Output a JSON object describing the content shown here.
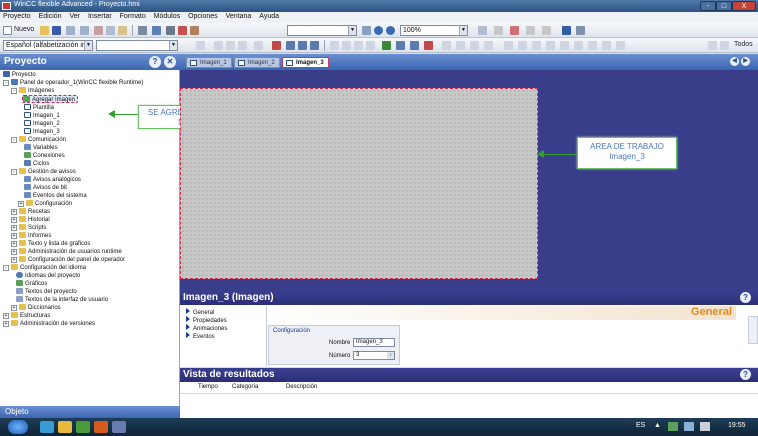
{
  "window": {
    "title": "WinCC flexible Advanced - Proyecto.hmi",
    "minimize": "-",
    "maximize": "□",
    "close": "X"
  },
  "menu": [
    "Proyecto",
    "Edición",
    "Ver",
    "Insertar",
    "Formato",
    "Módulos",
    "Opciones",
    "Ventana",
    "Ayuda"
  ],
  "toolbar": {
    "new_label": "Nuevo",
    "zoom_value": "100%",
    "language_combo": "Español (alfabetización in...",
    "todos_label": "Todos"
  },
  "project_panel": {
    "title": "Proyecto",
    "tree": {
      "root": "Proyecto",
      "operator_panel": "Panel de operador_1(WinCC flexible Runtime)",
      "imagenes": "Imágenes",
      "agregar_imagen": "Agregar Imagen",
      "plantilla": "Plantilla",
      "imagen_1": "Imagen_1",
      "imagen_2": "Imagen_2",
      "imagen_3": "Imagen_3",
      "comunicacion": "Comunicación",
      "variables": "Variables",
      "conexiones": "Conexiones",
      "ciclos": "Ciclos",
      "gestion_avisos": "Gestión de avisos",
      "avisos_analogicos": "Avisos analógicos",
      "avisos_bit": "Avisos de bit",
      "eventos_sistema": "Eventos del sistema",
      "configuracion": "Configuración",
      "recetas": "Recetas",
      "historial": "Historial",
      "scripts": "Scripts",
      "informes": "Informes",
      "texto_graficos": "Texto y lista de gráficos",
      "admin_usuarios": "Administración de usuarios runtime",
      "config_panel": "Configuración del panel de operador",
      "config_idioma": "Configuración del idioma",
      "idiomas_proyecto": "Idiomas del proyecto",
      "graficos": "Gráficos",
      "textos_proyecto": "Textos del proyecto",
      "textos_interfaz": "Textos de la interfaz de usuario",
      "diccionarios": "Diccionarios",
      "estructuras": "Estructuras",
      "admin_versiones": "Administración de versiones"
    }
  },
  "object_panel": {
    "title": "Objeto"
  },
  "editor_tabs": [
    "Imagen_1",
    "Imagen_2",
    "Imagen_3"
  ],
  "annotations": {
    "left_callout": "SE AGREGAN LAS IMÁGENES NECESARIAS.",
    "right_callout_line1": "AREA DE TRABAJO",
    "right_callout_line2": "Imagen_3"
  },
  "properties": {
    "title": "Imagen_3 (Imagen)",
    "categories": [
      "General",
      "Propiedades",
      "Animaciones",
      "Eventos"
    ],
    "section_label": "General",
    "group_title": "Configuración",
    "name_label": "Nombre",
    "name_value": "Imagen_3",
    "number_label": "Número",
    "number_value": "3"
  },
  "results": {
    "title": "Vista de resultados",
    "columns": [
      "Tiempo",
      "Categoría",
      "Descripción"
    ]
  },
  "taskbar": {
    "lang": "ES",
    "time": "19:55"
  },
  "colors": {
    "accent": "#3d66b2",
    "workspace": "#3a3e8a",
    "callout_border": "#6bbf6b",
    "callout_text": "#4a7abf"
  }
}
